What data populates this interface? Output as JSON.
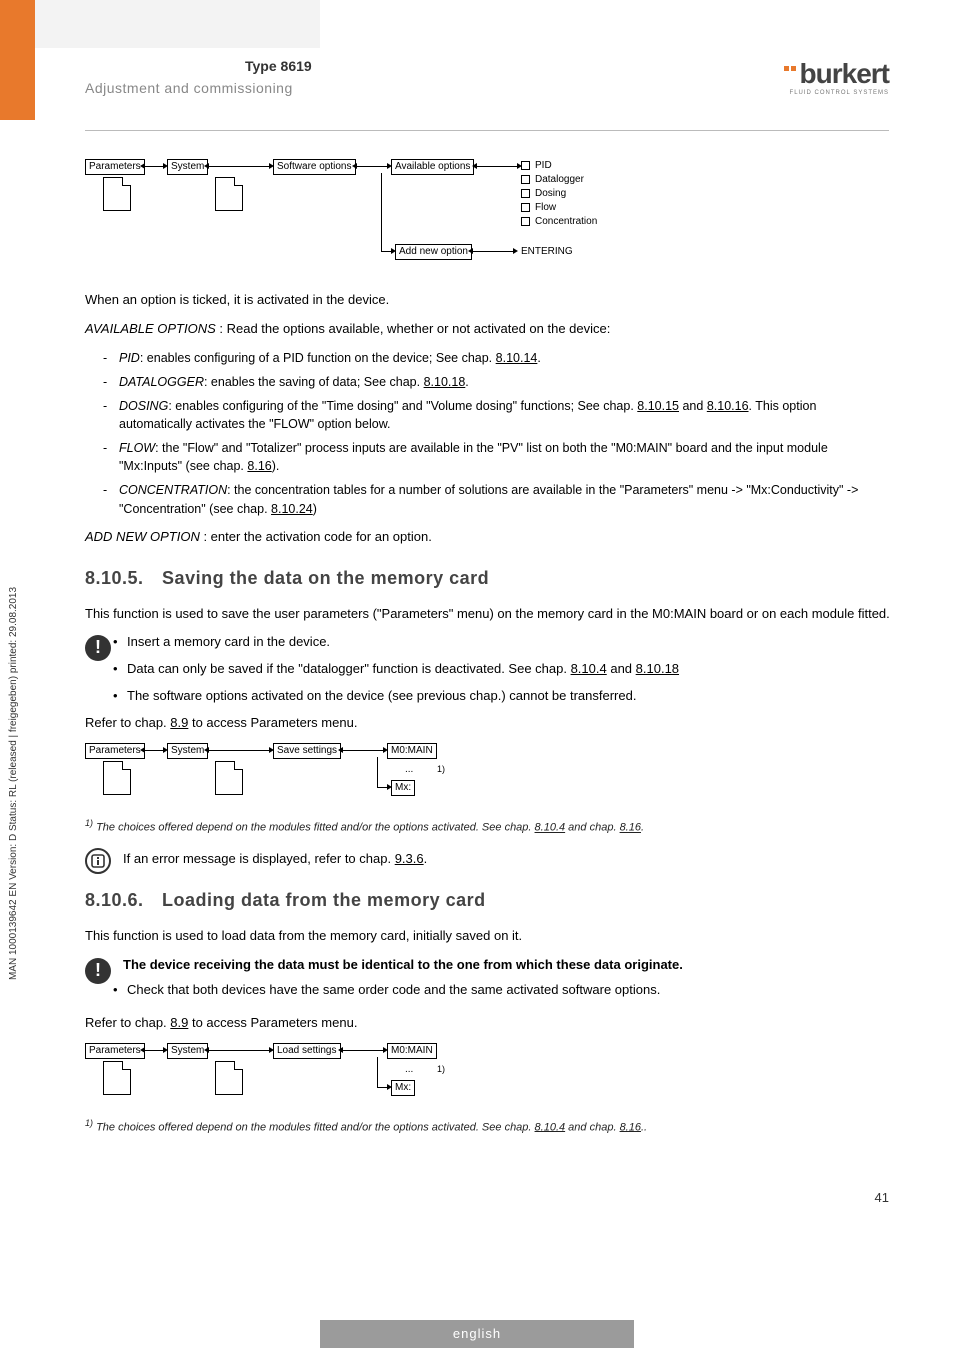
{
  "sidetext": "MAN 1000139642 EN Version: D Status: RL (released | freigegeben) printed: 29.08.2013",
  "header": {
    "type": "Type 8619",
    "section": "Adjustment and commissioning"
  },
  "logo": {
    "brand": "burkert",
    "tagline": "FLUID CONTROL SYSTEMS"
  },
  "diag1": {
    "parameters": "Parameters",
    "system": "System",
    "softopt": "Software options",
    "availopt": "Available options",
    "addnew": "Add new option",
    "entering": "ENTERING",
    "opts": [
      "PID",
      "Datalogger",
      "Dosing",
      "Flow",
      "Concentration"
    ]
  },
  "body": {
    "p_ticked": "When an option is ticked, it is activated in the device.",
    "avail_lead": "AVAILABLE OPTIONS",
    "avail_rest": " : Read the options available, whether or not activated on the device:",
    "li_pid_a": "PID",
    "li_pid_b": ": enables configuring of a PID function on the device; See chap. ",
    "li_pid_c": "8.10.14",
    "li_dl_a": "DATALOGGER",
    "li_dl_b": ": enables the saving of data; See chap. ",
    "li_dl_c": "8.10.18",
    "li_dos_a": "DOSING",
    "li_dos_b": ": enables configuring of the \"Time dosing\" and \"Volume dosing\" functions; See  chap. ",
    "li_dos_c": "8.10.15",
    "li_dos_d": " and ",
    "li_dos_e": "8.10.16",
    "li_dos_f": ". This option automatically activates the \"FLOW\" option below.",
    "li_flow_a": "FLOW",
    "li_flow_b": ": the \"Flow\" and \"Totalizer\" process inputs are available in the \"PV\" list on both the \"M0:MAIN\" board and the input module \"Mx:Inputs\" (see chap. ",
    "li_flow_c": "8.16",
    "li_flow_d": ").",
    "li_conc_a": "CONCENTRATION",
    "li_conc_b": ": the concentration tables for a number of solutions are available in the \"Parameters\" menu -> \"Mx:Conductivity\" -> \"Concentration\" (see chap. ",
    "li_conc_c": "8.10.24",
    "li_conc_d": ")",
    "addnew_lead": "ADD NEW OPTION",
    "addnew_rest": " : enter the activation code for an option.",
    "h_8105": "8.10.5. Saving the data on the memory card",
    "p_8105": "This function is used to save the user parameters (\"Parameters\" menu) on the memory card in the M0:MAIN board or on each module fitted.",
    "warn1_a": "Insert a memory card in the device.",
    "warn1_b_1": "Data can only be saved if the \"datalogger\" function is deactivated. See chap. ",
    "warn1_b_2": "8.10.4",
    "warn1_b_3": " and ",
    "warn1_b_4": "8.10.18",
    "warn1_c": "The software options activated on the device (see previous chap.) cannot be transferred.",
    "refer_a": "Refer to chap. ",
    "refer_b": "8.9",
    "refer_c": " to access Parameters menu.",
    "fn1_a": "1)",
    "fn1_b": " The choices offered depend on the modules fitted and/or the options activated. See chap. ",
    "fn1_c": "8.10.4",
    "fn1_d": " and chap. ",
    "fn1_e": "8.16",
    "fn1_f": ".",
    "info_a": "If an error message is displayed, refer to chap. ",
    "info_b": "9.3.6",
    "info_c": ".",
    "h_8106": "8.10.6. Loading data from the memory card",
    "p_8106": "This function is used to load data from the memory card, initially saved on it.",
    "warn2_a": "The device receiving the data must be identical to the one from which these data originate.",
    "warn2_b": "Check that both devices have the same order code and the same activated software options.",
    "fn2_f": ".."
  },
  "diag2": {
    "parameters": "Parameters",
    "system": "System",
    "save": "Save settings",
    "m0": "M0:MAIN",
    "mx": "Mx:",
    "dots": "...",
    "sup": "1)"
  },
  "diag3": {
    "parameters": "Parameters",
    "system": "System",
    "load": "Load settings",
    "m0": "M0:MAIN",
    "mx": "Mx:",
    "dots": "...",
    "sup": "1)"
  },
  "pagenum": "41",
  "footer": "english"
}
